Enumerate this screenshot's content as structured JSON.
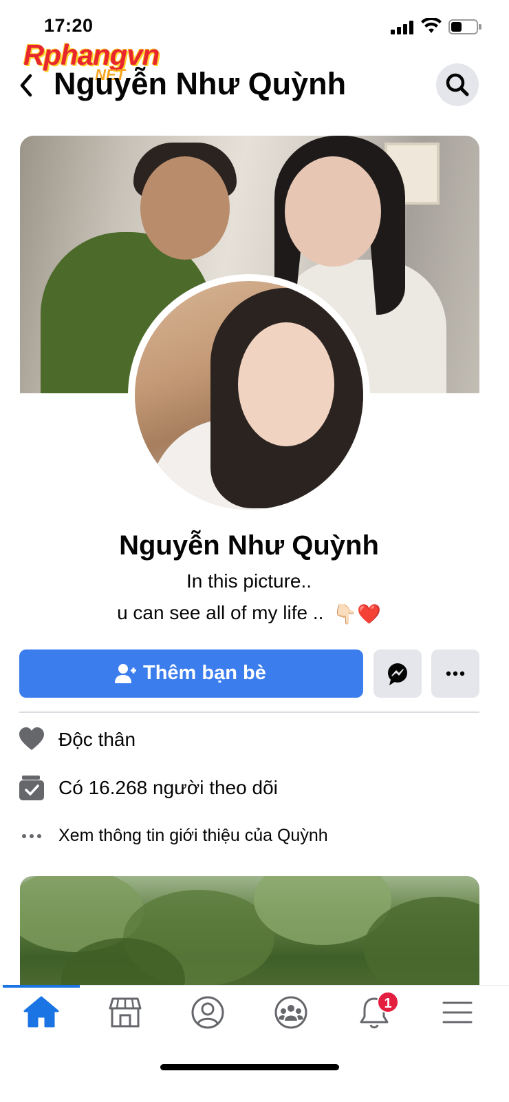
{
  "status_bar": {
    "time": "17:20"
  },
  "watermark": {
    "main": "Rphangvn",
    "suffix": ".NET"
  },
  "header": {
    "title": "Nguyễn Như Quỳnh"
  },
  "profile": {
    "name": "Nguyễn Như Quỳnh",
    "bio_line1": "In this picture..",
    "bio_line2": "u can see all of my life ..",
    "bio_emoji": "👇🏻❤️"
  },
  "actions": {
    "add_friend_label": "Thêm bạn bè"
  },
  "info": {
    "relationship": "Độc thân",
    "followers": "Có 16.268 người theo dõi",
    "about_link": "Xem thông tin giới thiệu của Quỳnh"
  },
  "tabs": [
    {
      "icon": "home-icon",
      "active": true
    },
    {
      "icon": "marketplace-icon",
      "active": false
    },
    {
      "icon": "profile-icon",
      "active": false
    },
    {
      "icon": "groups-icon",
      "active": false
    },
    {
      "icon": "notifications-icon",
      "active": false,
      "badge": "1"
    },
    {
      "icon": "menu-icon",
      "active": false
    }
  ],
  "colors": {
    "primary": "#3b7ded",
    "active_tab": "#1b74e4",
    "badge": "#e41e3f",
    "secondary_button": "#e4e6eb"
  }
}
